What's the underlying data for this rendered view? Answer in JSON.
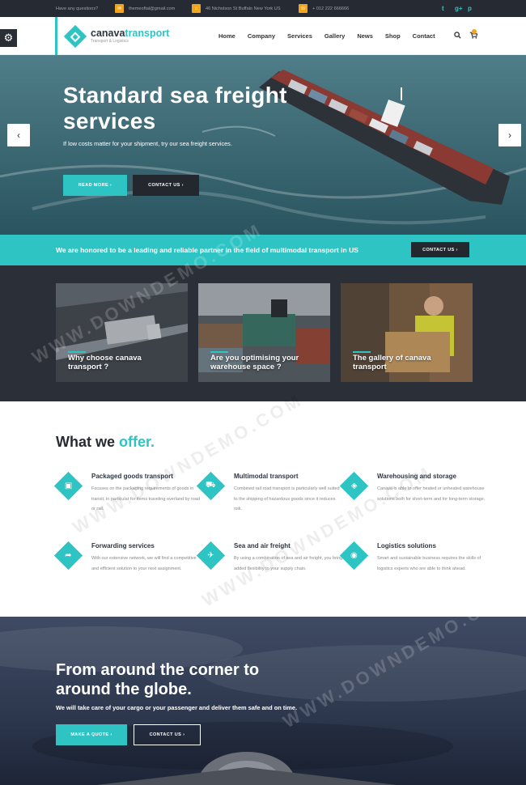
{
  "topbar": {
    "question": "Have any questions?",
    "email": "themeoftal@gmail.com",
    "address": "46 Nicholson St Buffalo New York US",
    "phone": "+ 012 222 666666",
    "social": [
      "twitter-icon",
      "google-plus-icon",
      "pinterest-icon"
    ]
  },
  "header": {
    "logo_main": "canava",
    "logo_accent": "transport",
    "tagline": "Transport & Logistics",
    "nav": [
      "Home",
      "Company",
      "Services",
      "Gallery",
      "News",
      "Shop",
      "Contact"
    ]
  },
  "hero": {
    "title_line1": "Standard sea freight",
    "title_line2": "services",
    "subtitle": "If low costs matter for your shipment, try our sea freight services.",
    "btn_primary": "Read more",
    "btn_secondary": "Contact us"
  },
  "band": {
    "text": "We are honored to be a leading and reliable partner in the field of multimodal transport in US",
    "button": "Contact us"
  },
  "cards": [
    {
      "title": "Why choose canava transport ?"
    },
    {
      "title": "Are you optimising your warehouse space ?"
    },
    {
      "title": "The gallery of canava transport"
    }
  ],
  "offer": {
    "title_dark": "What we",
    "title_accent": "offer.",
    "features": [
      {
        "title": "Packaged goods transport",
        "text": "Focuses on the packaging requirements of goods in transit, in particular for items traveling overland by road or rail.",
        "icon": "box-icon"
      },
      {
        "title": "Multimodal transport",
        "text": "Combined rail road transport is particularly well suited to the shipping of hazardous goods since it reduces risk.",
        "icon": "truck-icon"
      },
      {
        "title": "Warehousing and storage",
        "text": "Canava is able to offer heated or unheated warehouse solutions both for short-term and for long-term storage.",
        "icon": "cube-icon"
      },
      {
        "title": "Forwarding services",
        "text": "With our extensive network, we will find a competitive and efficient solution to your next assignment.",
        "icon": "forward-icon"
      },
      {
        "title": "Sea and air freight",
        "text": "By using a combination of sea and air freight, you bring added flexibility to your supply chain.",
        "icon": "plane-icon"
      },
      {
        "title": "Logistics solutions",
        "text": "Smart and sustainable business requires the skills of logistics experts who are able to think ahead.",
        "icon": "globe-icon"
      }
    ]
  },
  "globe": {
    "title_line1": "From around the corner to",
    "title_line2": "around the globe.",
    "text": "We will take care of your cargo or your passenger and deliver them safe and on time.",
    "btn_primary": "Make a quote",
    "btn_secondary": "Contact us"
  },
  "watermark": "WWW.DOWNDEMO.COM",
  "colors": {
    "accent": "#2ec4c4",
    "dark": "#262b33",
    "topbar_icon": "#f2a51a"
  }
}
